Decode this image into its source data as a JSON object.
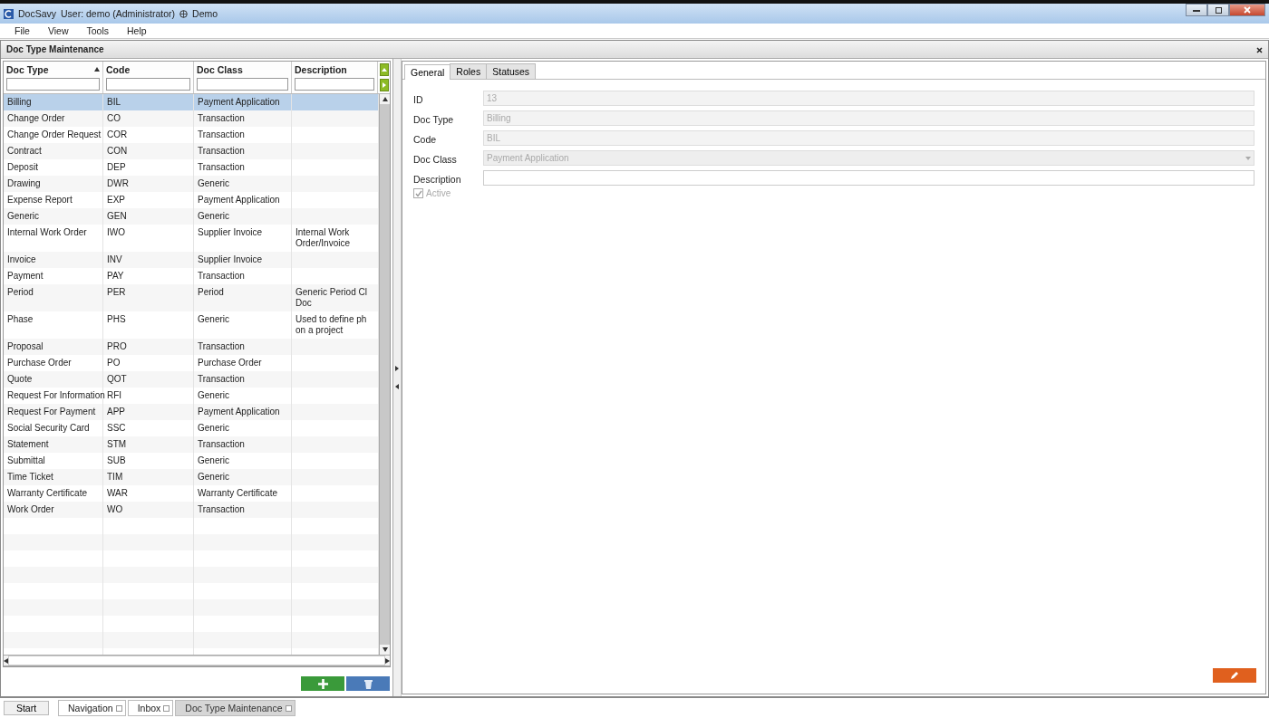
{
  "window": {
    "app": "DocSavy",
    "user": "User: demo (Administrator)",
    "org": "Demo"
  },
  "menu": [
    "File",
    "View",
    "Tools",
    "Help"
  ],
  "panel": {
    "title": "Doc Type Maintenance"
  },
  "grid": {
    "columns": [
      {
        "label": "Doc Type",
        "sorted": true
      },
      {
        "label": "Code",
        "sorted": false
      },
      {
        "label": "Doc Class",
        "sorted": false
      },
      {
        "label": "Description",
        "sorted": false
      }
    ],
    "rows": [
      {
        "cells": [
          "Billing",
          "BIL",
          "Payment Application"
        ],
        "selected": true
      },
      {
        "cells": [
          "Change Order",
          "CO",
          "Transaction"
        ],
        "selected": false
      },
      {
        "cells": [
          "Change Order Request",
          "COR",
          "Transaction"
        ],
        "selected": false
      },
      {
        "cells": [
          "Contract",
          "CON",
          "Transaction"
        ],
        "selected": false
      },
      {
        "cells": [
          "Deposit",
          "DEP",
          "Transaction"
        ],
        "selected": false
      },
      {
        "cells": [
          "Drawing",
          "DWR",
          "Generic"
        ],
        "selected": false
      },
      {
        "cells": [
          "Expense Report",
          "EXP",
          "Payment Application"
        ],
        "selected": false
      },
      {
        "cells": [
          "Generic",
          "GEN",
          "Generic"
        ],
        "selected": false
      },
      {
        "cells": [
          "Internal Work Order",
          "IWO",
          "Supplier Invoice",
          "Internal Work\nOrder/Invoice"
        ],
        "selected": false
      },
      {
        "cells": [
          "Invoice",
          "INV",
          "Supplier Invoice"
        ],
        "selected": false
      },
      {
        "cells": [
          "Payment",
          "PAY",
          "Transaction"
        ],
        "selected": false
      },
      {
        "cells": [
          "Period",
          "PER",
          "Period",
          "Generic Period Cl\nDoc"
        ],
        "selected": false
      },
      {
        "cells": [
          "Phase",
          "PHS",
          "Generic",
          "Used to define ph\non a project"
        ],
        "selected": false
      },
      {
        "cells": [
          "Proposal",
          "PRO",
          "Transaction"
        ],
        "selected": false
      },
      {
        "cells": [
          "Purchase Order",
          "PO",
          "Purchase Order"
        ],
        "selected": false
      },
      {
        "cells": [
          "Quote",
          "QOT",
          "Transaction"
        ],
        "selected": false
      },
      {
        "cells": [
          "Request For Information",
          "RFI",
          "Generic"
        ],
        "selected": false
      },
      {
        "cells": [
          "Request For Payment",
          "APP",
          "Payment Application"
        ],
        "selected": false
      },
      {
        "cells": [
          "Social Security Card",
          "SSC",
          "Generic"
        ],
        "selected": false
      },
      {
        "cells": [
          "Statement",
          "STM",
          "Transaction"
        ],
        "selected": false
      },
      {
        "cells": [
          "Submittal",
          "SUB",
          "Generic"
        ],
        "selected": false
      },
      {
        "cells": [
          "Time Ticket",
          "TIM",
          "Generic"
        ],
        "selected": false
      },
      {
        "cells": [
          "Warranty Certificate",
          "WAR",
          "Warranty Certificate"
        ],
        "selected": false
      },
      {
        "cells": [
          "Work Order",
          "WO",
          "Transaction"
        ],
        "selected": false
      }
    ]
  },
  "tabs": [
    {
      "label": "General",
      "selected": true
    },
    {
      "label": "Roles",
      "selected": false
    },
    {
      "label": "Statuses",
      "selected": false
    }
  ],
  "form": {
    "fields": [
      {
        "label": "ID",
        "value": "13",
        "kind": "text",
        "disabled": true
      },
      {
        "label": "Doc Type",
        "value": "Billing",
        "kind": "text",
        "disabled": true
      },
      {
        "label": "Code",
        "value": "BIL",
        "kind": "text",
        "disabled": true
      },
      {
        "label": "Doc Class",
        "value": "Payment Application",
        "kind": "select",
        "disabled": true
      },
      {
        "label": "Description",
        "kind": "text",
        "disabled": false
      }
    ],
    "active": {
      "label": "Active",
      "checked": true,
      "disabled": true
    }
  },
  "taskbar": {
    "start": "Start",
    "tabs": [
      {
        "label": "Navigation",
        "selected": false
      },
      {
        "label": "Inbox",
        "selected": false
      },
      {
        "label": "Doc Type Maintenance",
        "selected": true
      }
    ]
  }
}
